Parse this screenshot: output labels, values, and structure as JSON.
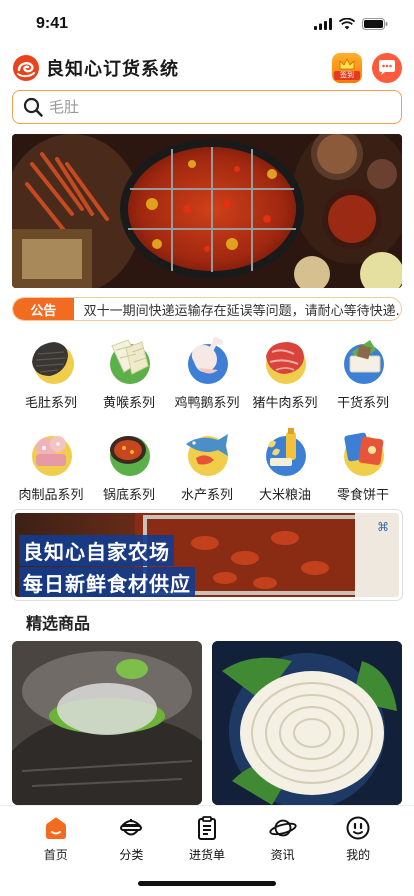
{
  "status": {
    "time": "9:41"
  },
  "header": {
    "title": "良知心订货系统",
    "checkin_label": "签到"
  },
  "search": {
    "placeholder": "毛肚"
  },
  "notice": {
    "tag": "公告",
    "text": "双十一期间快递运输存在延误等问题，请耐心等待快递..."
  },
  "categories": [
    {
      "label": "毛肚系列",
      "icon": "tripe-icon"
    },
    {
      "label": "黄喉系列",
      "icon": "aorta-icon"
    },
    {
      "label": "鸡鸭鹅系列",
      "icon": "poultry-icon"
    },
    {
      "label": "猪牛肉系列",
      "icon": "meat-icon"
    },
    {
      "label": "干货系列",
      "icon": "dry-goods-icon"
    },
    {
      "label": "肉制品系列",
      "icon": "meat-product-icon"
    },
    {
      "label": "锅底系列",
      "icon": "hotpot-base-icon"
    },
    {
      "label": "水产系列",
      "icon": "seafood-icon"
    },
    {
      "label": "大米粮油",
      "icon": "grain-oil-icon"
    },
    {
      "label": "零食饼干",
      "icon": "snack-icon"
    }
  ],
  "promo": {
    "line1": "良知心自家农场",
    "line2": "每日新鲜食材供应"
  },
  "section": {
    "title": "精选商品"
  },
  "tabs": [
    {
      "label": "首页",
      "icon": "home-icon",
      "active": true
    },
    {
      "label": "分类",
      "icon": "category-icon"
    },
    {
      "label": "进货单",
      "icon": "order-list-icon"
    },
    {
      "label": "资讯",
      "icon": "news-icon"
    },
    {
      "label": "我的",
      "icon": "profile-icon"
    }
  ],
  "colors": {
    "accent": "#f26b21",
    "search_border": "#f0a050"
  }
}
